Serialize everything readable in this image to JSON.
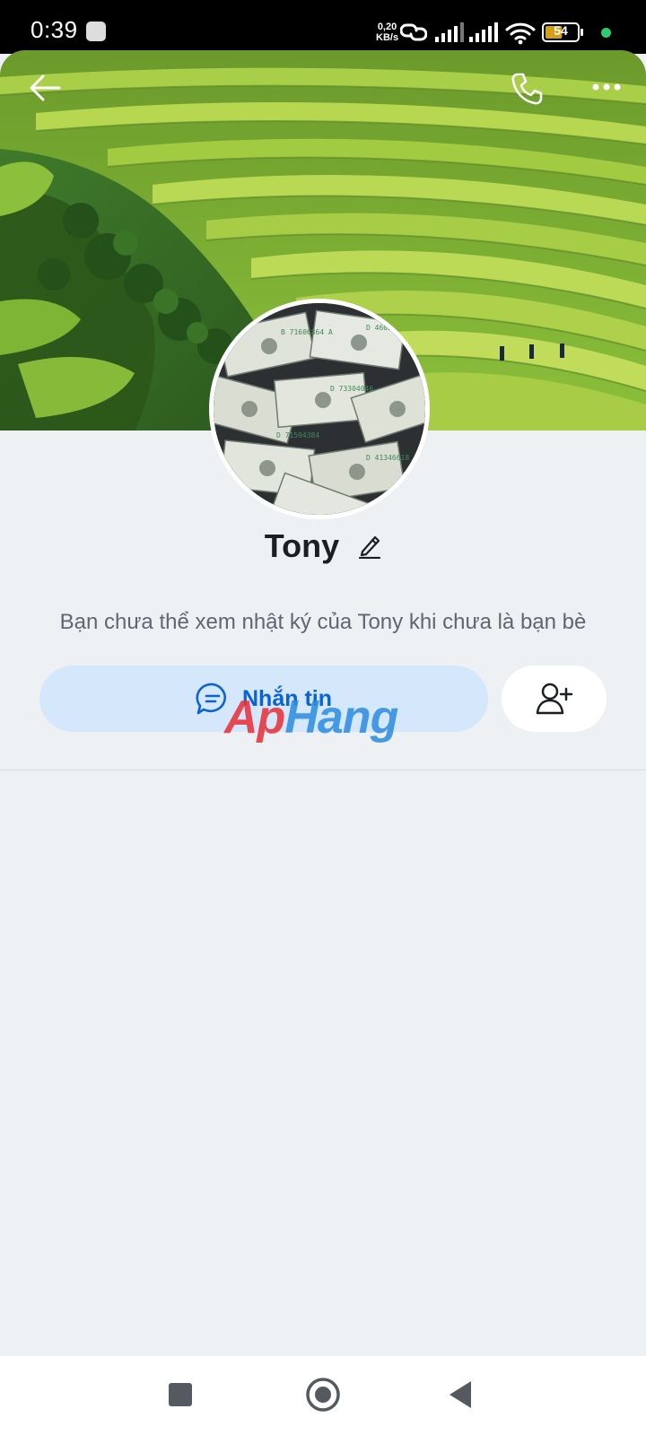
{
  "status_bar": {
    "time": "0:39",
    "net_speed_value": "0,20",
    "net_speed_unit": "KB/s",
    "battery_level": "54",
    "battery_color": "#d4a017",
    "dot_color": "#2ecc71"
  },
  "header": {
    "back_icon": "arrow-left-icon",
    "call_icon": "phone-icon",
    "more_icon": "more-horizontal-icon"
  },
  "profile": {
    "name": "Tony",
    "edit_icon": "pencil-icon",
    "info_text": "Bạn chưa thể xem nhật ký của Tony khi chưa là bạn bè"
  },
  "actions": {
    "message_label": "Nhắn tin",
    "message_icon": "chat-bubble-icon",
    "add_friend_icon": "add-user-icon"
  },
  "watermark": {
    "part1": "Ap",
    "part2": "Hang"
  },
  "nav": {
    "recents_icon": "square-icon",
    "home_icon": "circle-icon",
    "back_icon": "triangle-back-icon"
  },
  "colors": {
    "accent": "#0a63d6",
    "message_bg": "#d5e7fb",
    "page_bg": "#eef1f4"
  }
}
